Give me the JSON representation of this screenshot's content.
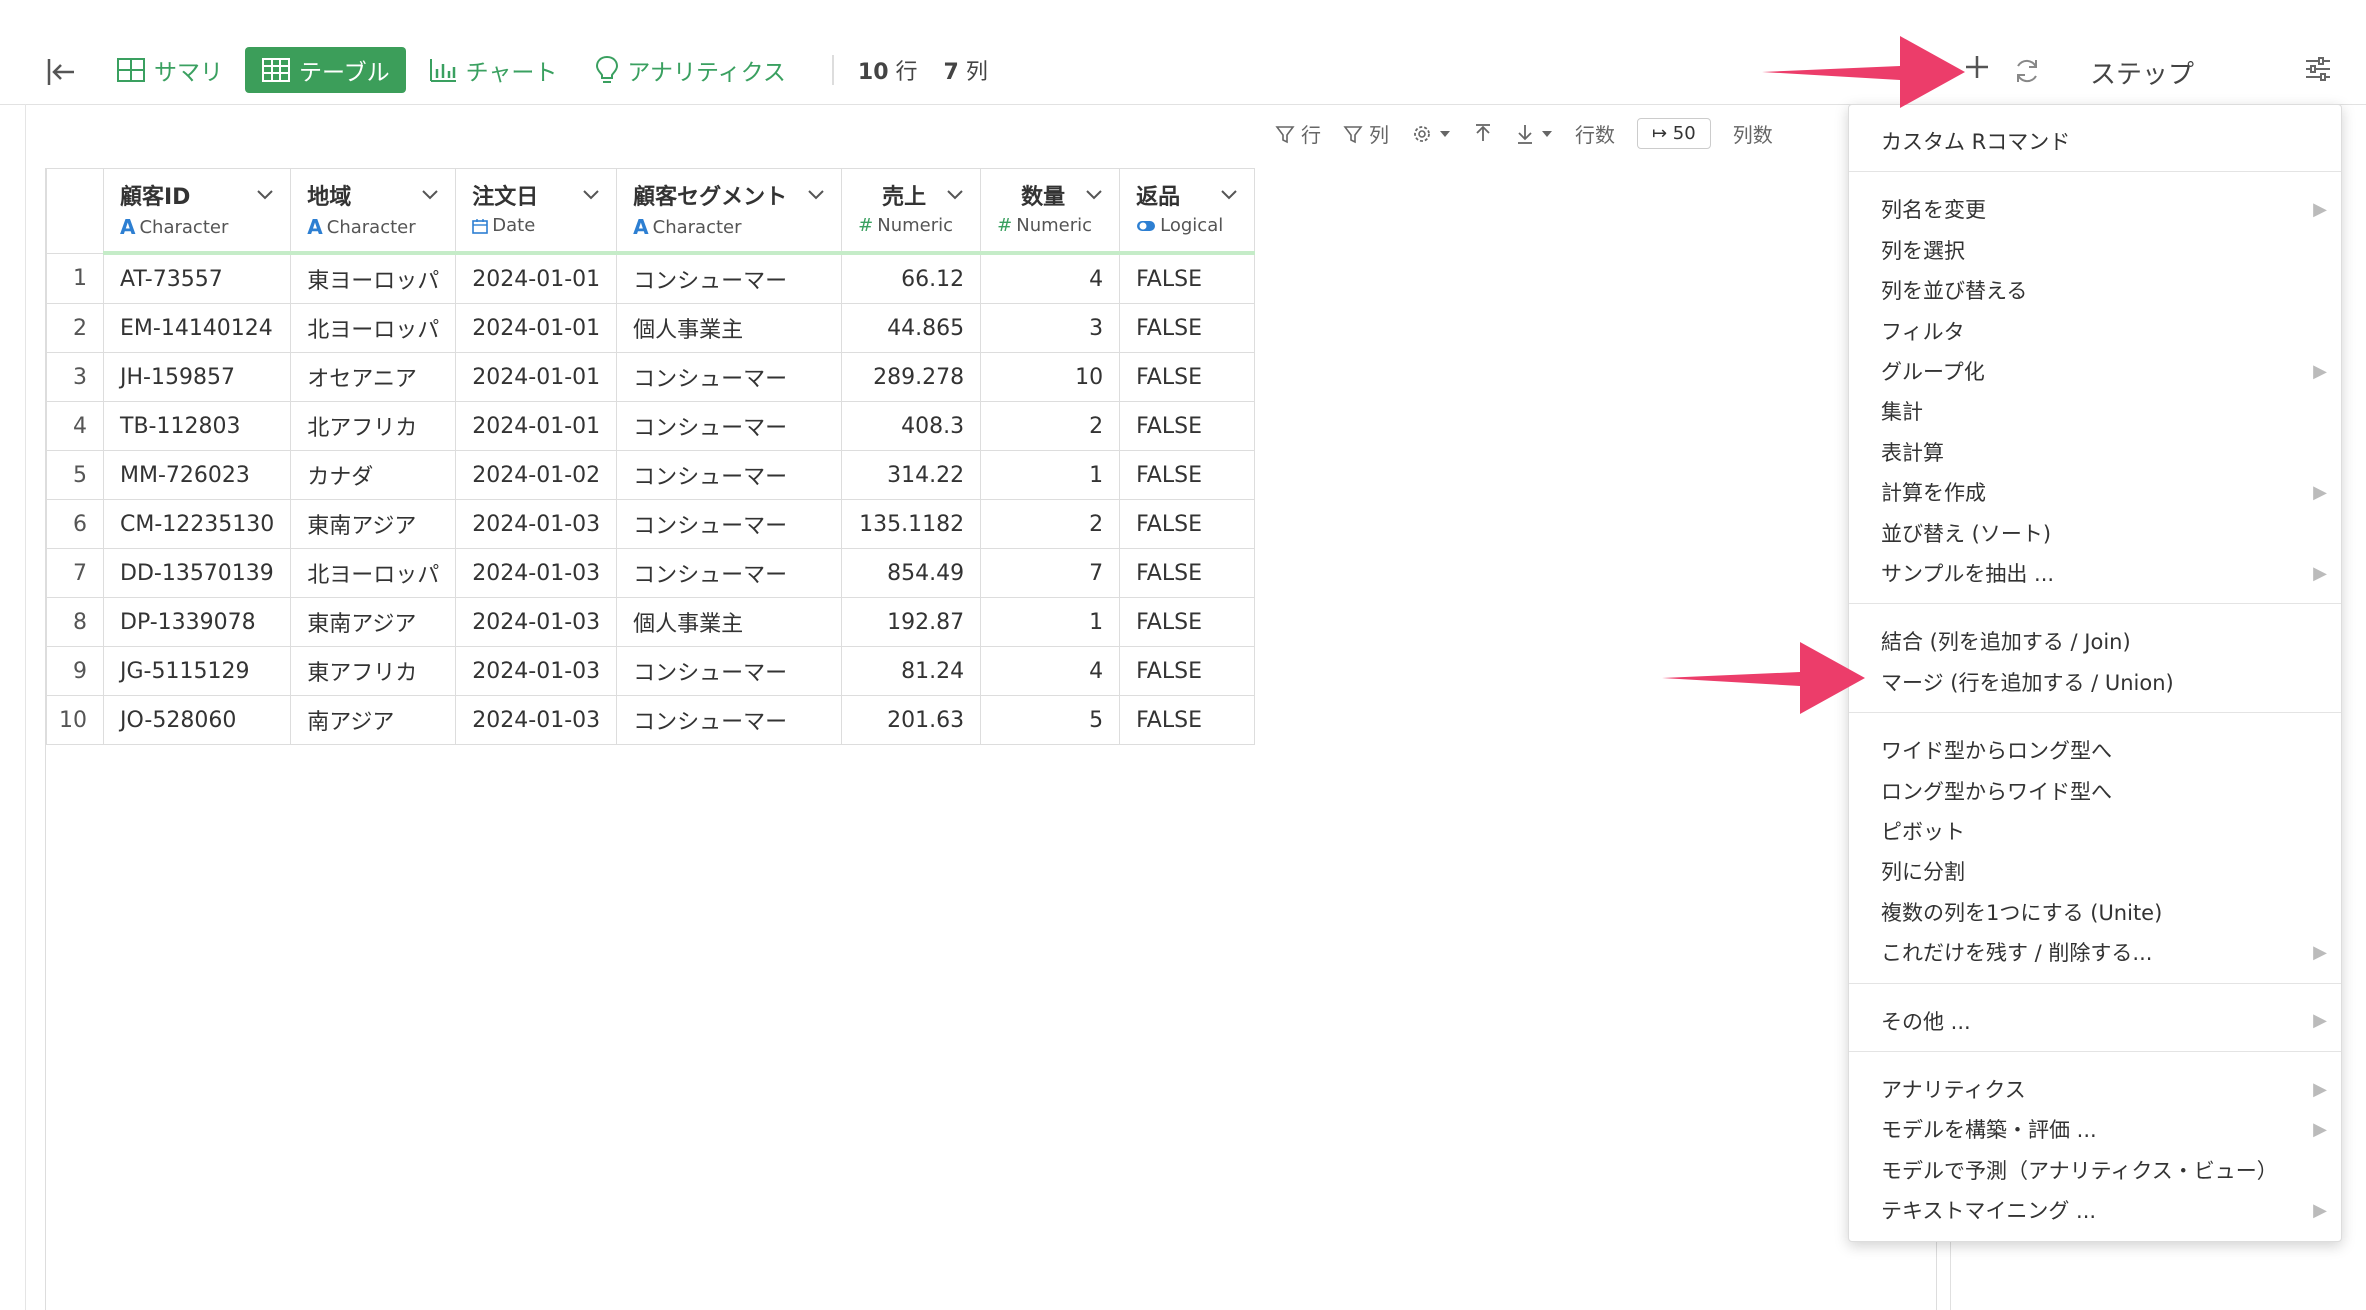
{
  "tabs": [
    {
      "label": "サマリ",
      "icon": "summary-icon",
      "active": false
    },
    {
      "label": "テーブル",
      "icon": "table-icon",
      "active": true
    },
    {
      "label": "チャート",
      "icon": "chart-icon",
      "active": false
    },
    {
      "label": "アナリティクス",
      "icon": "lightbulb-icon",
      "active": false
    }
  ],
  "counts": {
    "rows_num": "10",
    "rows_unit": "行",
    "cols_num": "7",
    "cols_unit": "列"
  },
  "steps_label": "ステップ",
  "toolbar": {
    "row_filter": "行",
    "col_filter": "列",
    "row_count_label": "行数",
    "row_count_value": "↦ 50",
    "col_count_label": "列数"
  },
  "columns": [
    {
      "name": "顧客ID",
      "type": "Character",
      "kind": "char",
      "align": "left"
    },
    {
      "name": "地域",
      "type": "Character",
      "kind": "char",
      "align": "left"
    },
    {
      "name": "注文日",
      "type": "Date",
      "kind": "date",
      "align": "left"
    },
    {
      "name": "顧客セグメント",
      "type": "Character",
      "kind": "char",
      "align": "left"
    },
    {
      "name": "売上",
      "type": "Numeric",
      "kind": "num",
      "align": "right"
    },
    {
      "name": "数量",
      "type": "Numeric",
      "kind": "num",
      "align": "right"
    },
    {
      "name": "返品",
      "type": "Logical",
      "kind": "logical",
      "align": "left"
    }
  ],
  "rows": [
    [
      "1",
      "AT-73557",
      "東ヨーロッパ",
      "2024-01-01",
      "コンシューマー",
      "66.12",
      "4",
      "FALSE"
    ],
    [
      "2",
      "EM-14140124",
      "北ヨーロッパ",
      "2024-01-01",
      "個人事業主",
      "44.865",
      "3",
      "FALSE"
    ],
    [
      "3",
      "JH-159857",
      "オセアニア",
      "2024-01-01",
      "コンシューマー",
      "289.278",
      "10",
      "FALSE"
    ],
    [
      "4",
      "TB-112803",
      "北アフリカ",
      "2024-01-01",
      "コンシューマー",
      "408.3",
      "2",
      "FALSE"
    ],
    [
      "5",
      "MM-726023",
      "カナダ",
      "2024-01-02",
      "コンシューマー",
      "314.22",
      "1",
      "FALSE"
    ],
    [
      "6",
      "CM-12235130",
      "東南アジア",
      "2024-01-03",
      "コンシューマー",
      "135.1182",
      "2",
      "FALSE"
    ],
    [
      "7",
      "DD-13570139",
      "北ヨーロッパ",
      "2024-01-03",
      "コンシューマー",
      "854.49",
      "7",
      "FALSE"
    ],
    [
      "8",
      "DP-1339078",
      "東南アジア",
      "2024-01-03",
      "個人事業主",
      "192.87",
      "1",
      "FALSE"
    ],
    [
      "9",
      "JG-5115129",
      "東アフリカ",
      "2024-01-03",
      "コンシューマー",
      "81.24",
      "4",
      "FALSE"
    ],
    [
      "10",
      "JO-528060",
      "南アジア",
      "2024-01-03",
      "コンシューマー",
      "201.63",
      "5",
      "FALSE"
    ]
  ],
  "menu": {
    "groups": [
      [
        {
          "label": "カスタム Rコマンド",
          "sub": false
        }
      ],
      [
        {
          "label": "列名を変更",
          "sub": true
        },
        {
          "label": "列を選択",
          "sub": false
        },
        {
          "label": "列を並び替える",
          "sub": false
        },
        {
          "label": "フィルタ",
          "sub": false
        },
        {
          "label": "グループ化",
          "sub": true
        },
        {
          "label": "集計",
          "sub": false
        },
        {
          "label": "表計算",
          "sub": false
        },
        {
          "label": "計算を作成",
          "sub": true
        },
        {
          "label": "並び替え (ソート)",
          "sub": false
        },
        {
          "label": "サンプルを抽出 ...",
          "sub": true
        }
      ],
      [
        {
          "label": "結合 (列を追加する / Join)",
          "sub": false
        },
        {
          "label": "マージ (行を追加する / Union)",
          "sub": false
        }
      ],
      [
        {
          "label": "ワイド型からロング型へ",
          "sub": false
        },
        {
          "label": "ロング型からワイド型へ",
          "sub": false
        },
        {
          "label": "ピボット",
          "sub": false
        },
        {
          "label": "列に分割",
          "sub": false
        },
        {
          "label": "複数の列を1つにする (Unite)",
          "sub": false
        },
        {
          "label": "これだけを残す / 削除する...",
          "sub": true
        }
      ],
      [
        {
          "label": "その他 ...",
          "sub": true
        }
      ],
      [
        {
          "label": "アナリティクス",
          "sub": true
        },
        {
          "label": "モデルを構築・評価 ...",
          "sub": true
        },
        {
          "label": "モデルで予測（アナリティクス・ビュー）",
          "sub": false
        },
        {
          "label": "テキストマイニング ...",
          "sub": true
        }
      ]
    ]
  },
  "colors": {
    "accent": "#3c9e5a",
    "arrow": "#ec3d6a",
    "type_char": "#2d7fd2",
    "type_num": "#3aa060"
  }
}
